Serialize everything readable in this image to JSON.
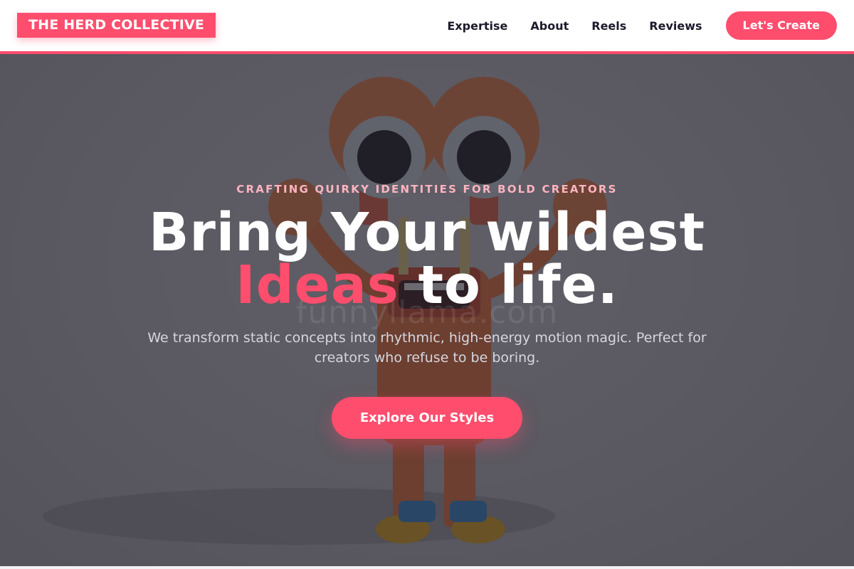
{
  "header": {
    "logo": "THE HERD COLLECTIVE",
    "nav": [
      "Expertise",
      "About",
      "Reels",
      "Reviews"
    ],
    "cta": "Let's Create"
  },
  "hero": {
    "kicker": "CRAFTING QUIRKY IDENTITIES FOR BOLD CREATORS",
    "headline_line1": "Bring Your wildest",
    "headline_accent": "Ideas",
    "headline_rest": " to life.",
    "subtitle": "We transform static concepts into rhythmic, high-energy motion magic. Perfect for creators who refuse to be boring.",
    "cta": "Explore Our Styles",
    "watermark": "funnyllama.com"
  },
  "colors": {
    "accent": "#ff4d6d",
    "nav_text": "#1b1b2a",
    "overlay": "#26242c"
  },
  "icons": {
    "hero_image": "cartoon-character-illustration"
  }
}
